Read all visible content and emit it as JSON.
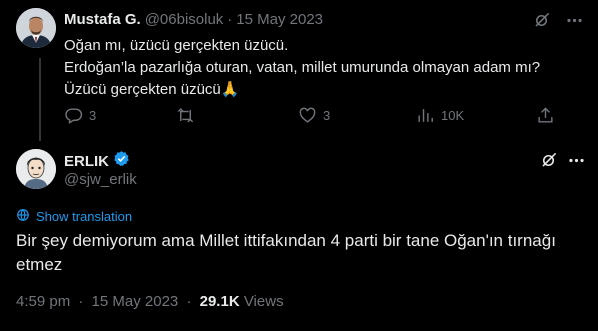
{
  "parent_tweet": {
    "author_name": "Mustafa G.",
    "author_handle": "@06bisoluk",
    "separator": "·",
    "date": "15 May 2023",
    "lines": [
      "Oğan mı, üzücü gerçekten üzücü.",
      "Erdoğan’la pazarlığa oturan, vatan, millet umurunda olmayan adam mı?",
      "Üzücü gerçekten üzücü🙏"
    ],
    "actions": {
      "replies": "3",
      "retweets": "",
      "likes": "3",
      "views": "10K"
    }
  },
  "main_tweet": {
    "author_name": "ERLIK",
    "author_handle": "@sjw_erlik",
    "show_translation": "Show translation",
    "text": "Bir şey demiyorum ama Millet ittifakından 4 parti bir tane Oğan'ın tırnağı etmez",
    "time": "4:59 pm",
    "separator": "·",
    "date": "15 May 2023",
    "views_count": "29.1K",
    "views_label": "Views"
  },
  "colors": {
    "background": "#000000",
    "text_primary": "#e7e9ea",
    "text_secondary": "#71767b",
    "link_blue": "#1d9bf0",
    "verified_badge": "#1d9bf0",
    "divider": "#333639"
  }
}
